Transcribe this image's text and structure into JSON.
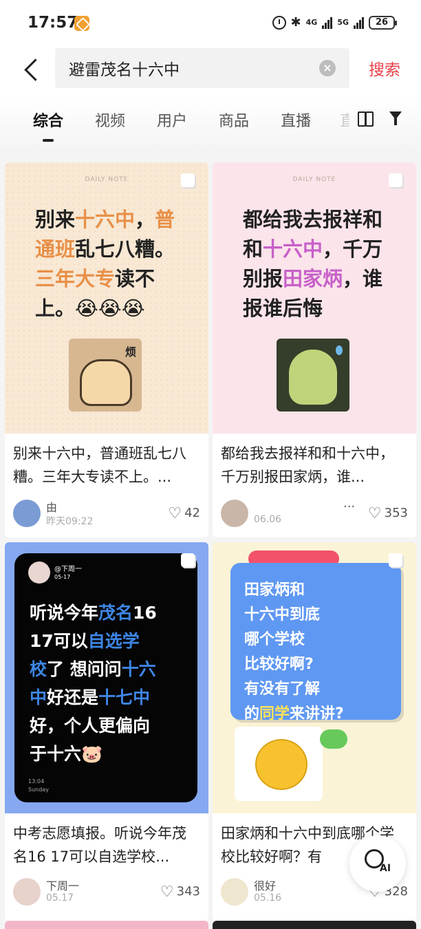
{
  "status_bar": {
    "time": "17:57",
    "network_1": "4G",
    "network_2": "5G",
    "battery": "26"
  },
  "search": {
    "query": "避雷茂名十六中",
    "button_label": "搜索"
  },
  "tabs": [
    "综合",
    "视频",
    "用户",
    "商品",
    "直播"
  ],
  "tab_overflow": "直",
  "cover_badge": "DAILY NOTE",
  "cards": [
    {
      "cover_lines": [
        [
          {
            "t": "别来"
          },
          {
            "t": "十六中",
            "c": "hl-o"
          },
          {
            "t": "，"
          },
          {
            "t": "普",
            "c": "hl-o"
          }
        ],
        [
          {
            "t": "通班",
            "c": "hl-o"
          },
          {
            "t": "乱七八糟。"
          }
        ],
        [
          {
            "t": "三年大专",
            "c": "hl-o"
          },
          {
            "t": "读不"
          }
        ],
        [
          {
            "t": "上。😭😭😭"
          }
        ]
      ],
      "sticker_text": "烦",
      "title": "别来十六中，普通班乱七八糟。三年大专读不上。...",
      "author": "由",
      "date": "昨天09:22",
      "likes": "42"
    },
    {
      "cover_lines": [
        [
          {
            "t": "都给我去报祥和"
          }
        ],
        [
          {
            "t": "和"
          },
          {
            "t": "十六中",
            "c": "hl-p"
          },
          {
            "t": "，千万"
          }
        ],
        [
          {
            "t": "别报"
          },
          {
            "t": "田家炳",
            "c": "hl-p"
          },
          {
            "t": "，谁"
          }
        ],
        [
          {
            "t": "报谁后悔"
          }
        ]
      ],
      "title": "都给我去报祥和和十六中，千万别报田家炳，谁...",
      "author": "",
      "date": "06.06",
      "more": "···",
      "likes": "353"
    },
    {
      "phone_user": "@下周一",
      "phone_date": "05-17",
      "cover_lines": [
        [
          {
            "t": "听说今年"
          },
          {
            "t": "茂名",
            "c": "hl-b"
          },
          {
            "t": "16"
          }
        ],
        [
          {
            "t": " 17可以"
          },
          {
            "t": "自选学",
            "c": "hl-b"
          }
        ],
        [
          {
            "t": "校",
            "c": "hl-b"
          },
          {
            "t": "了 想问问"
          },
          {
            "t": "十六",
            "c": "hl-b"
          }
        ],
        [
          {
            "t": "中",
            "c": "hl-b"
          },
          {
            "t": "好还是"
          },
          {
            "t": "十七中",
            "c": "hl-b"
          }
        ],
        [
          {
            "t": "好，个人更偏向"
          }
        ],
        [
          {
            "t": "于十六🐷"
          }
        ]
      ],
      "phone_footer_1": "13:04",
      "phone_footer_2": "Sunday",
      "title": "中考志愿填报。听说今年茂名16 17可以自选学校...",
      "author": "下周一",
      "date": "05.17",
      "likes": "343"
    },
    {
      "cover_lines": [
        [
          {
            "t": "田家炳和"
          }
        ],
        [
          {
            "t": "十六中到底"
          }
        ],
        [
          {
            "t": "哪个学校"
          }
        ],
        [
          {
            "t": "比较好啊?"
          }
        ],
        [
          {
            "t": "有没有了解"
          }
        ],
        [
          {
            "t": "的"
          },
          {
            "t": "同学",
            "c": "hl-w"
          },
          {
            "t": "来讲讲?"
          }
        ]
      ],
      "emoji": "😉",
      "title": "田家炳和十六中到底哪个学校比较好啊？有",
      "author": "很好",
      "date": "05.16",
      "likes": "328"
    }
  ],
  "ai_button": {
    "label": "AI"
  },
  "colors": {
    "accent": "#e8424a",
    "highlight_orange": "#e89048",
    "highlight_purple": "#c760c9",
    "highlight_blue": "#3d86e6"
  }
}
